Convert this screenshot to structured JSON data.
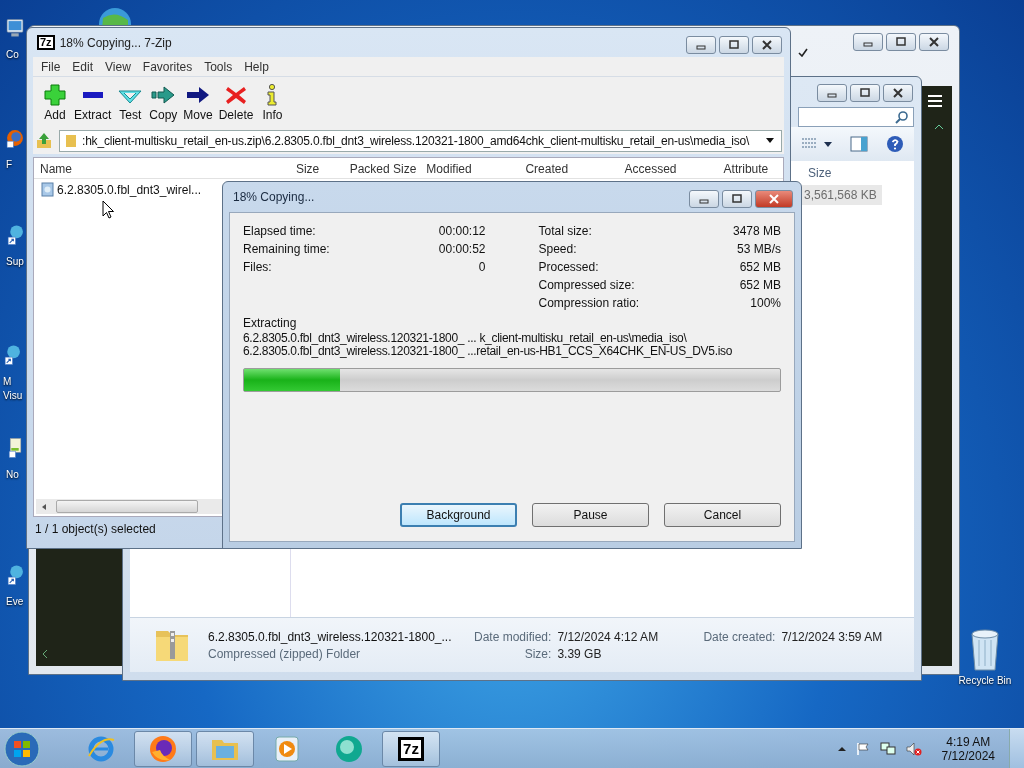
{
  "desktop_icons": [
    {
      "kind": "computer",
      "lines": [
        "Co"
      ]
    },
    {
      "kind": "firefox",
      "lines": [
        "F"
      ]
    },
    {
      "kind": "shortcut",
      "lines": [
        "Sup"
      ]
    },
    {
      "kind": "shortcut",
      "lines": [
        "M",
        "Visu"
      ]
    },
    {
      "kind": "notepad",
      "lines": [
        "No"
      ]
    },
    {
      "kind": "shortcut",
      "lines": [
        "Eve"
      ]
    },
    {
      "kind": "recycle",
      "lines": [
        "Recycle Bin"
      ]
    }
  ],
  "explorer": {
    "column": "Size",
    "cell": "3,561,568 KB",
    "details": {
      "name": "6.2.8305.0.fbl_dnt3_wireless.120321-1800_...",
      "type": "Compressed (zipped) Folder",
      "fields": [
        {
          "label": "Date modified:",
          "value": "7/12/2024 4:12 AM"
        },
        {
          "label": "Size:",
          "value": "3.39 GB"
        },
        {
          "label": "Date created:",
          "value": "7/12/2024 3:59 AM"
        }
      ]
    }
  },
  "sevenzip": {
    "logo": "7z",
    "title": "18% Copying... 7-Zip",
    "menu": [
      "File",
      "Edit",
      "View",
      "Favorites",
      "Tools",
      "Help"
    ],
    "toolbar": [
      {
        "kind": "add",
        "label": "Add"
      },
      {
        "kind": "extract",
        "label": "Extract"
      },
      {
        "kind": "test",
        "label": "Test"
      },
      {
        "kind": "copy",
        "label": "Copy"
      },
      {
        "kind": "move",
        "label": "Move"
      },
      {
        "kind": "delete",
        "label": "Delete"
      },
      {
        "kind": "info",
        "label": "Info"
      }
    ],
    "address": ":hk_client-multisku_retail_en-us.zip\\6.2.8305.0.fbl_dnt3_wireless.120321-1800_amd64chk_client-multisku_retail_en-us\\media_iso\\",
    "columns": [
      "Name",
      "Size",
      "Packed Size",
      "Modified",
      "Created",
      "Accessed",
      "Attribute"
    ],
    "rows": [
      {
        "name": "6.2.8305.0.fbl_dnt3_wirel..."
      }
    ],
    "status": "1 / 1 object(s) selected"
  },
  "dialog": {
    "title": "18% Copying...",
    "left_stats": [
      {
        "label": "Elapsed time:",
        "value": "00:00:12"
      },
      {
        "label": "Remaining time:",
        "value": "00:00:52"
      },
      {
        "label": "Files:",
        "value": "0"
      }
    ],
    "right_stats": [
      {
        "label": "Total size:",
        "value": "3478 MB"
      },
      {
        "label": "Speed:",
        "value": "53 MB/s"
      },
      {
        "label": "Processed:",
        "value": "652 MB"
      },
      {
        "label": "Compressed size:",
        "value": "652 MB"
      },
      {
        "label": "Compression ratio:",
        "value": "100%"
      }
    ],
    "operation": "Extracting",
    "paths": [
      "6.2.8305.0.fbl_dnt3_wireless.120321-1800_ ... k_client-multisku_retail_en-us\\media_iso\\",
      "6.2.8305.0.fbl_dnt3_wireless.120321-1800_ ...retail_en-us-HB1_CCS_X64CHK_EN-US_DV5.iso"
    ],
    "progress": {
      "level": 0.18
    },
    "buttons": [
      {
        "label": "Background",
        "focused": true
      },
      {
        "label": "Pause",
        "focused": false
      },
      {
        "label": "Cancel",
        "focused": false
      }
    ]
  },
  "taskbar": {
    "apps": [
      {
        "kind": "ie",
        "running": false
      },
      {
        "kind": "firefox",
        "running": true
      },
      {
        "kind": "explorer",
        "running": true
      },
      {
        "kind": "media",
        "running": false
      },
      {
        "kind": "orb",
        "running": false
      },
      {
        "kind": "sevenzip",
        "running": true,
        "text": "7z"
      }
    ],
    "time": "4:19 AM",
    "date": "7/12/2024"
  }
}
